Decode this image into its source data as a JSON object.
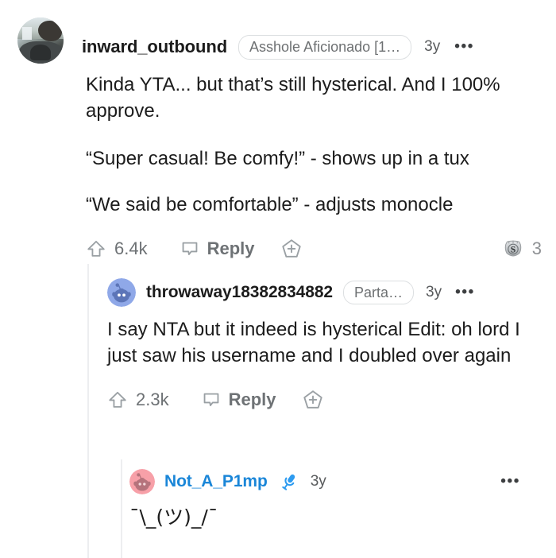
{
  "comments": [
    {
      "id": "c1",
      "username": "inward_outbound",
      "is_op": false,
      "avatar_type": "photo",
      "flair": "Asshole Aficionado [1…",
      "age": "3y",
      "overflow": "•••",
      "paragraphs": [
        "Kinda YTA... but that’s still hysterical. And I 100% approve.",
        "“Super casual! Be comfy!” - shows up in a tux",
        "“We said be comfortable” - adjusts monocle"
      ],
      "actions": {
        "upvote_icon": "upvote-arrow-icon",
        "score": "6.4k",
        "reply_icon": "comment-bubble-icon",
        "reply_label": "Reply",
        "award_icon": "award-plus-icon"
      },
      "awards": {
        "badge_icon": "silver-award-icon",
        "badge_letter": "S",
        "count": "3"
      }
    },
    {
      "id": "c2",
      "username": "throwaway18382834882",
      "is_op": false,
      "avatar_type": "snoo-blue",
      "flair": "Parta…",
      "age": "3y",
      "overflow": "•••",
      "paragraphs": [
        "I say NTA but it indeed is hysterical Edit: oh lord I just saw his username and I doubled over again"
      ],
      "actions": {
        "upvote_icon": "upvote-arrow-icon",
        "score": "2.3k",
        "reply_icon": "comment-bubble-icon",
        "reply_label": "Reply",
        "award_icon": "award-plus-icon"
      },
      "awards": null
    },
    {
      "id": "c3",
      "username": "Not_A_P1mp",
      "is_op": true,
      "avatar_type": "snoo-pink",
      "flair": null,
      "op_icon": "microphone-icon",
      "age": "3y",
      "overflow": "•••",
      "paragraphs": [
        "¯\\_(ツ)_/¯"
      ],
      "actions": null,
      "awards": null
    }
  ],
  "colors": {
    "op_blue": "#1a86d8",
    "mic_blue": "#2d9bf0",
    "snoo_blue_bg": "#8fa8e8",
    "snoo_pink_bg": "#f7a0a8",
    "thread_line": "#edeef0",
    "muted_text": "#6e7275",
    "body_text": "#1c1c1c"
  }
}
